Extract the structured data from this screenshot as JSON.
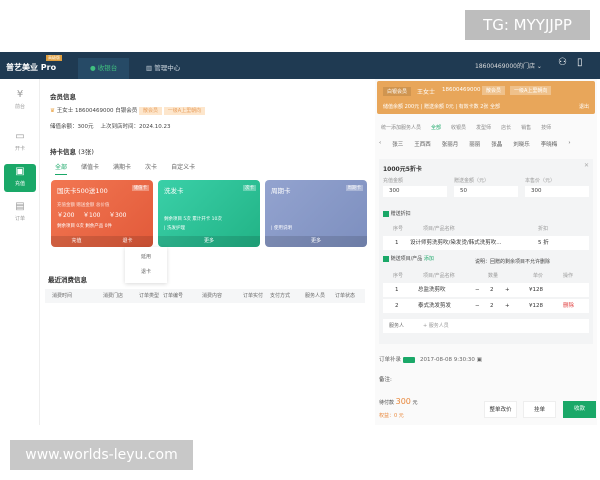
{
  "watermarks": {
    "top": "TG: MYYJJPP",
    "bottom": "www.worlds-leyu.com"
  },
  "nav": {
    "brand": "普艺美业 Pro",
    "edition": "高级版",
    "tabs": [
      "收银台",
      "管理中心"
    ],
    "store": "18600469000的门店",
    "icons": [
      "user-icon",
      "mobile-icon"
    ]
  },
  "sidebar": [
    {
      "label": "前台",
      "icon": "yen-icon"
    },
    {
      "label": "开卡",
      "icon": "card-icon"
    },
    {
      "label": "充值",
      "icon": "wallet-icon"
    },
    {
      "label": "订单",
      "icon": "clipboard-icon"
    }
  ],
  "member": {
    "title": "会员信息",
    "name": "王女士",
    "phone": "18600469000",
    "level": "白银会员",
    "tag1": "散会员",
    "tag2": "一级A上里朝向",
    "balance": "储值余额：300元",
    "last_visit": "上次到店时间：2024.10.23"
  },
  "cards_section": {
    "title": "持卡信息",
    "count": "(3张)",
    "tabs": [
      "全部",
      "储值卡",
      "满期卡",
      "次卡",
      "自定义卡"
    ],
    "cards": [
      {
        "name": "国庆卡500送100",
        "type": "储值卡",
        "line1": "充值金额  赠送金额  总价值",
        "values": [
          "￥200",
          "￥100",
          "￥300"
        ],
        "line3": "剩余项目 0次  剩余产品 0件",
        "actions": [
          "充值",
          "退卡"
        ],
        "color": "#ef6a4a"
      },
      {
        "name": "洗发卡",
        "type": "次卡",
        "line1": "剩余项目 5次  累计开卡 10次",
        "line2": "| 洗发护理",
        "actions": [
          "更多"
        ],
        "color": "#2fc79a"
      },
      {
        "name": "周期卡",
        "type": "周期卡",
        "line2": "| 使用说明",
        "actions": [
          "更多"
        ],
        "color": "#8a9cc8"
      }
    ],
    "dropdown": [
      "延用",
      "退卡"
    ]
  },
  "consumption": {
    "title": "最近消费信息",
    "columns": [
      "消费时间",
      "消费门店",
      "订单类型",
      "订单编号",
      "消费内容",
      "订单实付",
      "支付方式",
      "服务人员",
      "订单状态"
    ]
  },
  "order": {
    "header": {
      "level": "白银会员",
      "name": "王女士",
      "phone": "18600469000",
      "tag1": "散会员",
      "tag2": "一级A上里朝向",
      "summary": "储值余额 200元  |  赠送余额 0元  |  有效卡数 2张 全部",
      "exit": "退出"
    },
    "staff_label": "统一添加服务人员",
    "staff_filters": [
      "全部",
      "收银员",
      "发型师",
      "店长",
      "销售",
      "技师"
    ],
    "staff": [
      "张三",
      "王西西",
      "张丽月",
      "丽丽",
      "张晶",
      "刘晓乐",
      "李晓梅"
    ],
    "card_form": {
      "title": "1000元5折卡",
      "fields": [
        {
          "label": "充值金额",
          "value": "300"
        },
        {
          "label": "赠送金额（元）",
          "value": "50"
        },
        {
          "label": "本售价（元）",
          "value": "300"
        }
      ],
      "gift_label": "赠送折扣",
      "gift_columns": [
        "序号",
        "项目/产品名称",
        "折扣"
      ],
      "gift_rows": [
        [
          "1",
          "设计师剪洗剪吹/染发烫/韩式洗剪吹...",
          "5 折"
        ]
      ],
      "items_label": "随送项目/产品",
      "add": "添加",
      "note": "说明：回赠的剩余项目不允许删除",
      "item_columns": [
        "序号",
        "项目/产品名称",
        "数量",
        "单价",
        "操作"
      ],
      "item_rows": [
        [
          "1",
          "总监洗剪吹",
          "2",
          "¥128",
          ""
        ],
        [
          "2",
          "泰式洗发剪发",
          "2",
          "¥128",
          "删除"
        ]
      ],
      "staff_field": "服务人",
      "staff_placeholder": "+ 服务人员"
    },
    "supplement_label": "订单补录",
    "datetime": "2017-08-08 9:30:30",
    "remark": "备注:",
    "due_label": "待付款",
    "due": "300",
    "due_unit": "元",
    "discount": "权益：0 元",
    "buttons": [
      "整单改价",
      "挂单",
      "收款"
    ]
  },
  "colors": {
    "nav": "#1f3a52",
    "accent": "#1aa868",
    "orange": "#e8a65a"
  }
}
